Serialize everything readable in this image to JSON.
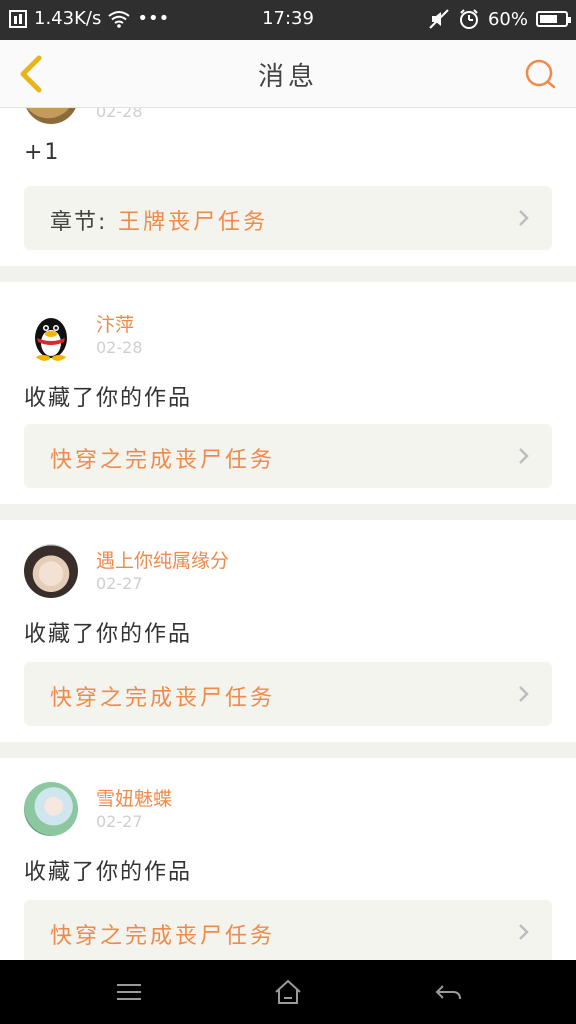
{
  "status_bar": {
    "network_speed": "1.43K/s",
    "dots": "•••",
    "time": "17:39",
    "battery": "60%"
  },
  "header": {
    "title": "消息"
  },
  "messages": [
    {
      "date": "02-28",
      "text": "+1",
      "chapter_prefix": "章节:",
      "chapter_title": "王牌丧尸任务"
    },
    {
      "user": "汴萍",
      "date": "02-28",
      "text": "收藏了你的作品",
      "chapter_title": "快穿之完成丧尸任务"
    },
    {
      "user": "遇上你纯属缘分",
      "date": "02-27",
      "text": "收藏了你的作品",
      "chapter_title": "快穿之完成丧尸任务"
    },
    {
      "user": "雪妞魅蝶",
      "date": "02-27",
      "text": "收藏了你的作品",
      "chapter_title": "快穿之完成丧尸任务"
    }
  ],
  "colors": {
    "accent": "#f08a4b",
    "card_bg": "#f4f4ef",
    "back_arrow": "#e8b41a"
  },
  "icons": {
    "back": "chevron-left-icon",
    "search": "search-icon",
    "chevron": "chevron-right-icon",
    "menu": "menu-icon",
    "home": "home-icon",
    "return": "back-icon"
  }
}
